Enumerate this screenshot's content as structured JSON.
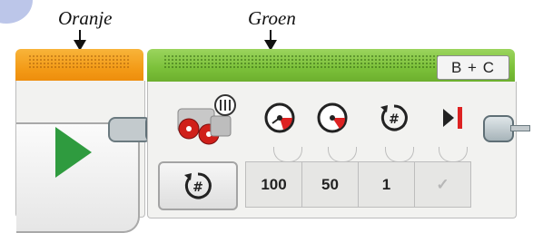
{
  "annotations": {
    "orange_label": "Oranje",
    "green_label": "Groen"
  },
  "start_block": {
    "color": "#f39a16",
    "icon": "play-icon"
  },
  "move_tank_block": {
    "color": "#7cc13a",
    "ports": "B + C",
    "mode_icon": "rotations-icon",
    "parameters": [
      {
        "icon": "left-power-icon",
        "value": "100"
      },
      {
        "icon": "right-power-icon",
        "value": "50"
      },
      {
        "icon": "rotations-icon",
        "value": "1"
      },
      {
        "icon": "brake-at-end-icon",
        "value": "✓"
      }
    ]
  }
}
